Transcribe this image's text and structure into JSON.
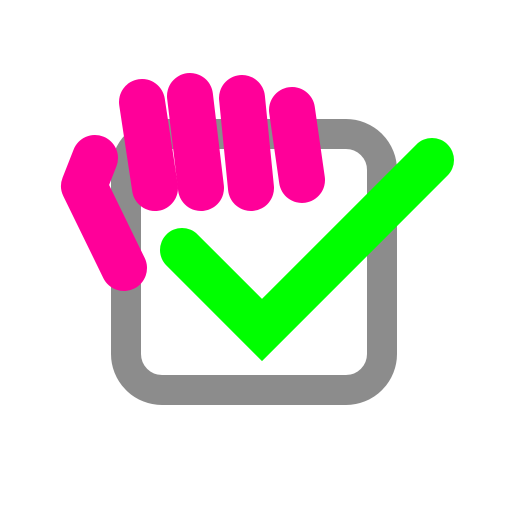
{
  "icon": {
    "name": "grab-checkbox-icon",
    "description_tag": "hand-grabbing-checked-checkbox",
    "colors": {
      "checkbox_outline": "#8c8c8c",
      "checkbox_fill": "#ffffff",
      "checkmark": "#00ff00",
      "hand": "#ff0099",
      "background": "#ffffff"
    }
  }
}
